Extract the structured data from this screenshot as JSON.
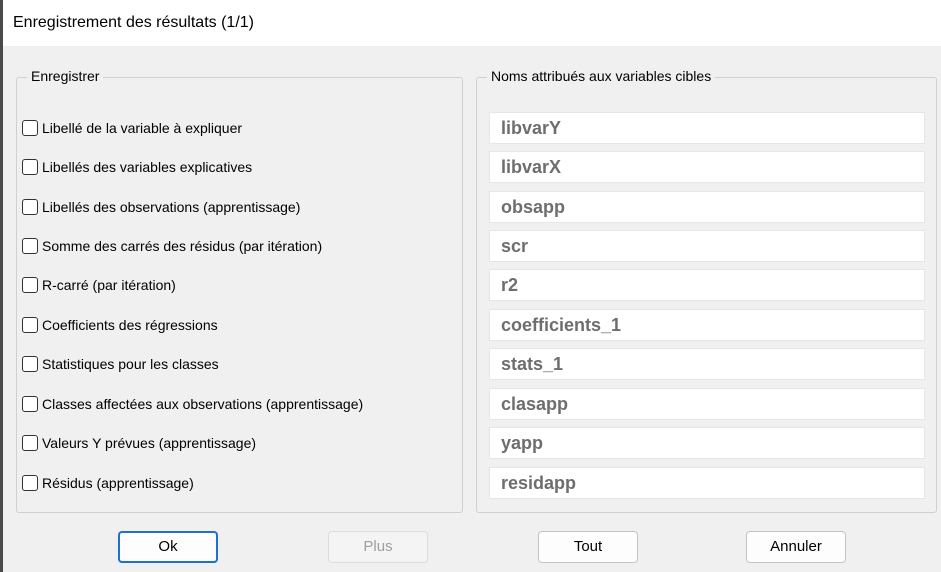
{
  "window": {
    "title": "Enregistrement des résultats (1/1)"
  },
  "save_group": {
    "legend": "Enregistrer",
    "items": [
      {
        "label": "Libellé de la variable à expliquer",
        "checked": false
      },
      {
        "label": "Libellés des variables explicatives",
        "checked": false
      },
      {
        "label": "Libellés des observations (apprentissage)",
        "checked": false
      },
      {
        "label": "Somme des carrés des résidus (par itération)",
        "checked": false
      },
      {
        "label": "R-carré (par itération)",
        "checked": false
      },
      {
        "label": "Coefficients des régressions",
        "checked": false
      },
      {
        "label": "Statistiques pour les classes",
        "checked": false
      },
      {
        "label": "Classes affectées aux observations (apprentissage)",
        "checked": false
      },
      {
        "label": "Valeurs Y prévues (apprentissage)",
        "checked": false
      },
      {
        "label": "Résidus (apprentissage)",
        "checked": false
      }
    ]
  },
  "names_group": {
    "legend": "Noms attribués aux variables cibles",
    "fields": [
      "libvarY",
      "libvarX",
      "obsapp",
      "scr",
      "r2",
      "coefficients_1",
      "stats_1",
      "clasapp",
      "yapp",
      "residapp"
    ]
  },
  "buttons": {
    "ok": "Ok",
    "plus": "Plus",
    "tout": "Tout",
    "annuler": "Annuler"
  }
}
